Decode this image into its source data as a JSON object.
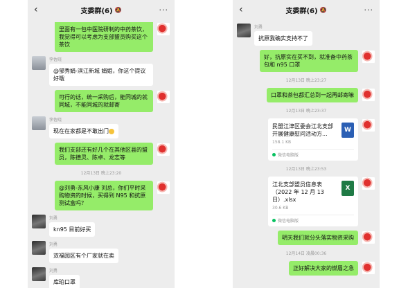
{
  "chat_title": "支委群(6)",
  "back_glyph": "‹",
  "more_glyph": "···",
  "mute_glyph": "🔕",
  "left": {
    "m1": "里面有一包中医院研制的中药茶饮，我觉得可以考虑为支部盟员购买这个茶饮",
    "s2": "李佐晓",
    "m2": "@邹秀娟-滨江新城 娟姐，你这个提议好哦",
    "m3": "可行的话，统一采购后，能同城的就同城，不能同城的就邮寄",
    "s4": "李佐晓",
    "m4": "现在在家都是不敢出门",
    "m5": "我们支部还有好几个在其他区县的盟员，陈德灵、陈卓、龙志等",
    "ts1": "12月13日 晚上23:20",
    "m6": "@刘勇-东风小康 刘总，你们平时采购物资的时候，买得到 N95 和抗原测试盒吗？",
    "s7": "刘勇",
    "m7": "kn95 目前好买",
    "s8": "刘勇",
    "m8": "双福园区有个厂家就在卖",
    "s9": "刘勇",
    "m9": "库珀口罩"
  },
  "right": {
    "s1": "刘勇",
    "m1": "抗原我确实支持不了",
    "m2": "好，抗原实在买不到，就准备中药茶包和 n95 口罩",
    "ts1": "12月13日 晚上23:27",
    "m3": "口罩和茶包都汇总到一起再邮寄嘛",
    "ts2": "12月13日 晚上23:37",
    "f1_name": "民盟江津区委会江北支部开展健康慰问活动方...",
    "f1_size": "158.1 KB",
    "f1_icon": "W",
    "f1_source": "微信电脑版",
    "ts3": "12月13日 晚上23:53",
    "f2_name": "江北支部盟员信息表（2022 年 12 月 13 日）.xlsx",
    "f2_size": "30.6 KB",
    "f2_icon": "X",
    "f2_source": "微信电脑版",
    "m4": "明天我们就分头落实物资采购",
    "ts4": "12月14日 凌晨00:36",
    "m5": "正好解决大家的燃眉之急"
  }
}
